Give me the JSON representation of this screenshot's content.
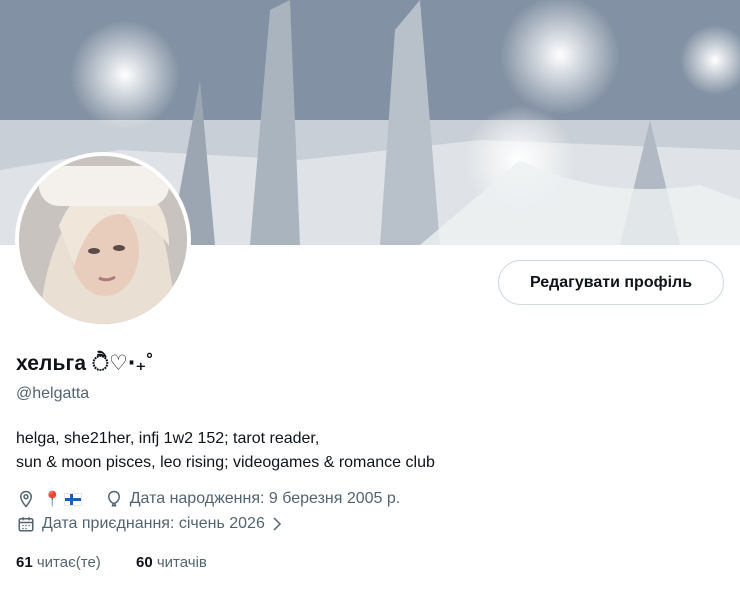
{
  "profile": {
    "display_name": "хельга ੈ♡‧₊˚",
    "handle": "@helgatta",
    "edit_button_label": "Редагувати профіль",
    "bio_lines": [
      "helga, she21her, infj 1w2 152; tarot reader,",
      "sun & moon pisces, leo rising; videogames & romance club"
    ],
    "location_emoji": "📍",
    "location_flag": "flag-finland",
    "birthday": "Дата народження: 9 березня 2005 р.",
    "joined": "Дата приєднання: січень 2026",
    "following_count": "61",
    "following_label": "читає(те)",
    "followers_count": "60",
    "followers_label": "читачів"
  },
  "icons": {
    "location": "location-pin-icon",
    "birthday": "balloon-icon",
    "joined": "calendar-icon",
    "joined_chevron": "chevron-right-icon"
  },
  "colors": {
    "text": "#0f1419",
    "secondary_text": "#536471",
    "button_border": "#cfd9de"
  }
}
